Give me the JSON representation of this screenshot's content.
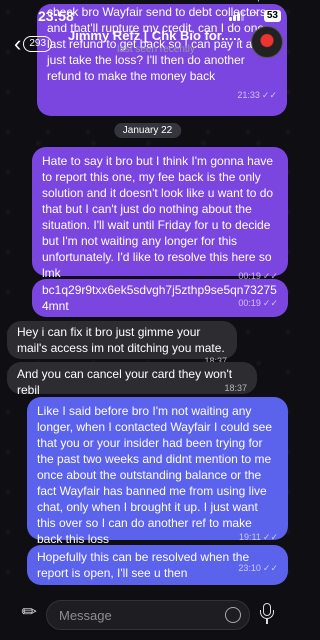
{
  "status": {
    "time": "23:58",
    "battery": "53"
  },
  "header": {
    "back_count": "293",
    "title": "Jimmy Refz [ Chk Bio for...",
    "subtitle": "last seen recently"
  },
  "date_divider": "January 22",
  "messages": [
    {
      "text": "Not sure there's much that can be done, check bro Wayfair send to debt collectors and that'll rupture my credit, can I do one last refund to get back so I can pay it and just take the loss? I'll then do another refund to make the money back",
      "time": "21:33",
      "dir": "out"
    },
    {
      "text": "Hate to say it bro but I think I'm gonna have to report this one, my fee back is the only solution and it doesn't look like u want to do that but I can't just do nothing about the situation. I'll wait until Friday for u to decide but I'm not waiting any longer for this unfortunately. I'd like to resolve this here so lmk",
      "time": "00:19",
      "dir": "out"
    },
    {
      "text": "bc1q29r9txx6ek5sdvgh7j5zthp9se5qn732754mnt",
      "time": "00:19",
      "dir": "out"
    },
    {
      "text": "Hey i can fix it bro just gimme your mail's access im not ditching you mate.",
      "time": "18:37",
      "dir": "in"
    },
    {
      "text": "And you can cancel your card they won't rebil",
      "time": "18:37",
      "dir": "in"
    },
    {
      "text": "Like I said before bro I'm not waiting any longer, when I contacted Wayfair I could see that you or your insider had been trying for the past two weeks and didnt mention to me once about the outstanding balance or the fact Wayfair has banned me from using live chat, only when I brought it up. I just want this over so I can do another ref to make back this loss",
      "time": "19:11",
      "dir": "out"
    },
    {
      "text": "Hopefully this can be resolved when the report is open, I'll see u then",
      "time": "23:10",
      "dir": "out"
    }
  ],
  "input": {
    "placeholder": "Message"
  },
  "colors": {
    "outgoing": "#7b46e0",
    "outgoing_late": "#5b62ec",
    "incoming": "#2c2c31",
    "background": "#0e0e13"
  }
}
